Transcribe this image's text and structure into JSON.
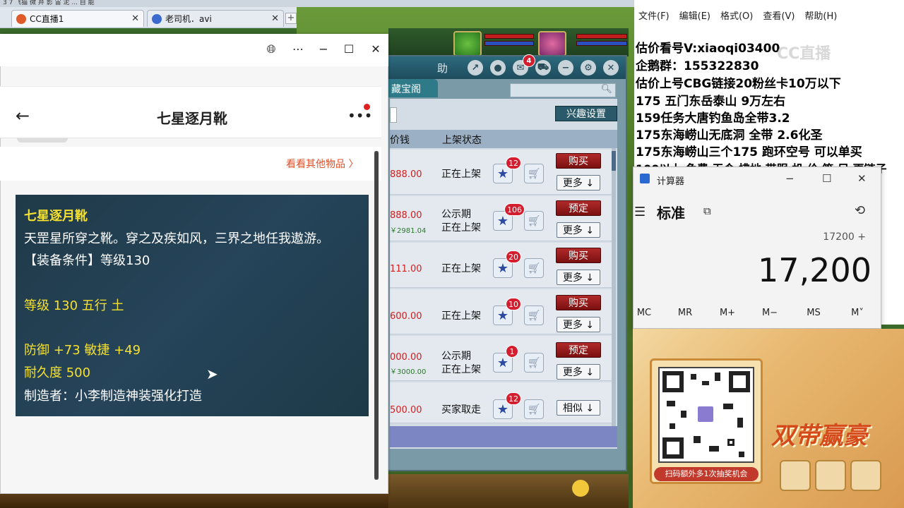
{
  "browser": {
    "top_strip": "3 7 飞猫 微 弃 影 宙 泥 ... 自 能",
    "tabs": [
      {
        "label": "CC直播1"
      },
      {
        "label": "老司机．avi"
      }
    ]
  },
  "game": {
    "tab_label": "藏宝阁",
    "toolbar_letters": "助",
    "notif_count": "4",
    "interest_button": "兴趣设置",
    "headers": {
      "price": "价钱",
      "status": "上架状态"
    },
    "rows": [
      {
        "price": "888.00",
        "price2": "",
        "status1": "正在上架",
        "status2": "",
        "fav": "12",
        "action": "购买",
        "more": "更多 ↓"
      },
      {
        "price": "888.00",
        "price2": "￥2981.04",
        "status1": "公示期",
        "status2": "正在上架",
        "fav": "106",
        "action": "预定",
        "more": "更多 ↓"
      },
      {
        "price": "111.00",
        "price2": "",
        "status1": "正在上架",
        "status2": "",
        "fav": "20",
        "action": "购买",
        "more": "更多 ↓"
      },
      {
        "price": "600.00",
        "price2": "",
        "status1": "正在上架",
        "status2": "",
        "fav": "10",
        "action": "购买",
        "more": "更多 ↓"
      },
      {
        "price": "000.00",
        "price2": "￥3000.00",
        "status1": "公示期",
        "status2": "正在上架",
        "fav": "1",
        "action": "预定",
        "more": "更多 ↓"
      },
      {
        "price": "500.00",
        "price2": "",
        "status1": "买家取走",
        "status2": "",
        "fav": "12",
        "action": "",
        "more": "相似 ↓"
      }
    ]
  },
  "phone": {
    "title": "七星逐月靴",
    "more_link": "看看其他物品 〉",
    "item": {
      "name": "七星逐月靴",
      "desc": "天罡星所穿之靴。穿之及疾如风，三界之地任我遨游。",
      "req": "【装备条件】等级130",
      "level": "等级 130 五行 土",
      "attrs": "防御 +73 敏捷 +49",
      "durability": "耐久度 500",
      "maker": "制造者：小李制造神装强化打造"
    }
  },
  "notepad": {
    "menu": [
      "文件(F)",
      "编辑(E)",
      "格式(O)",
      "查看(V)",
      "帮助(H)"
    ],
    "lines": [
      "估价看号V:xiaoqi03400",
      "企鹅群：155322830",
      "估价上号CBG链接20粉丝卡10万以下",
      "175 五门东岳泰山  9万左右",
      "159任务大唐钓鱼岛全带3.2",
      "175东海崂山无底洞  全带    2.6化圣",
      "175东海崂山三个175 跑环空号 可以单买",
      "100以上 免费 无令 拂地 带服 机 价 签 另 更链子"
    ],
    "watermark": "CC直播"
  },
  "calculator": {
    "title": "计算器",
    "mode": "标准",
    "expression": "17200 +",
    "display": "17,200",
    "memory": [
      "MC",
      "MR",
      "M+",
      "M−",
      "MS",
      "M˅"
    ]
  },
  "promo": {
    "caption": "扫码额外多1次抽奖机会",
    "headline": "双带赢豪"
  }
}
